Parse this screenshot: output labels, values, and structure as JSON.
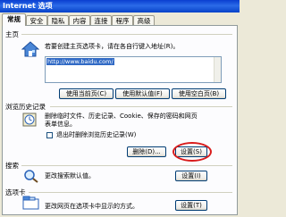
{
  "window": {
    "title": "Internet 选项"
  },
  "tabs": [
    {
      "label": "常规",
      "active": true
    },
    {
      "label": "安全"
    },
    {
      "label": "隐私"
    },
    {
      "label": "内容"
    },
    {
      "label": "连接"
    },
    {
      "label": "程序"
    },
    {
      "label": "高级"
    }
  ],
  "homepage": {
    "section_label": "主页",
    "description": "若要创建主页选项卡，请在各自行键入地址(R)。",
    "url": "http://www.baidu.com/",
    "buttons": [
      "使用当前页(C)",
      "使用默认值(F)",
      "使用空白页(B)"
    ]
  },
  "history": {
    "section_label": "浏览历史记录",
    "description_line1": "删除临时文件、历史记录、Cookie、保存的密码和网页",
    "description_line2": "表单信息。",
    "checkbox_label": "退出时删除浏览历史记录(W)",
    "checkbox_checked": false,
    "delete_button": "删除(D)...",
    "settings_button": "设置(S)"
  },
  "search": {
    "section_label": "搜索",
    "description": "更改搜索默认值。",
    "settings_button": "设置(I)"
  },
  "tabs_section": {
    "section_label": "选项卡",
    "description": "更改网页在选项卡中显示的方式。",
    "settings_button": "设置(T)"
  },
  "colors": {
    "highlight_circle": "#d91b1b",
    "titlebar": "#0a3fd0"
  }
}
